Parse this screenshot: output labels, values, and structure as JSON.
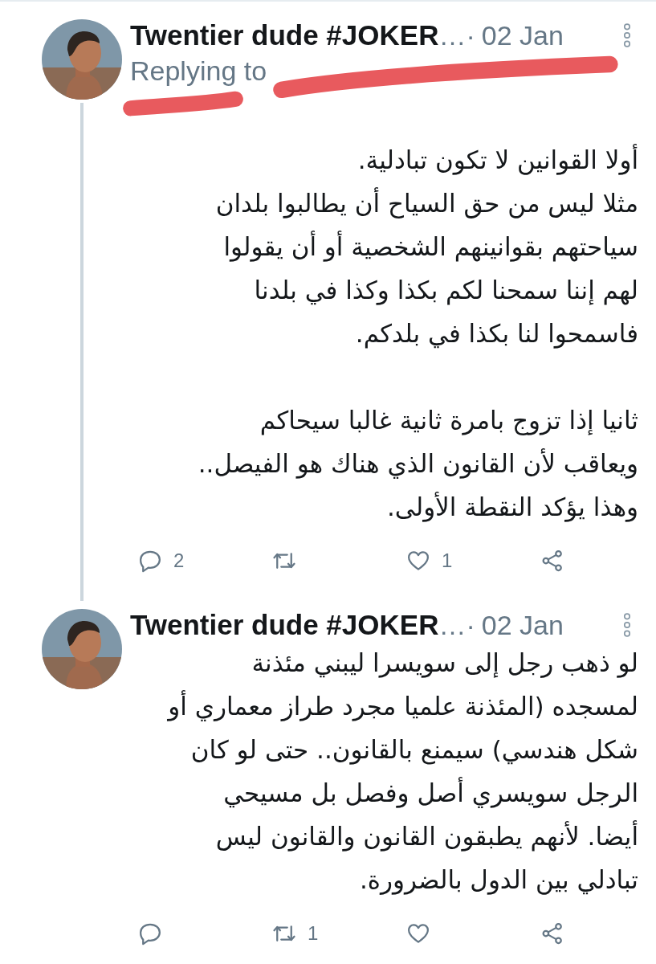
{
  "tweets": [
    {
      "author": "Twentier dude #JOKER",
      "truncation": "…",
      "separator": "·",
      "date": "02 Jan",
      "thread_continues": true,
      "replying_to": "Replying to",
      "paragraphs": [
        "أولا القوانين لا تكون تبادلية.\nمثلا ليس من حق السياح أن يطالبوا بلدان\nسياحتهم بقوانينهم الشخصية أو أن يقولوا\nلهم إننا سمحنا لكم بكذا وكذا في بلدنا\nفاسمحوا لنا بكذا في بلدكم.",
        "ثانيا إذا تزوج بامرة ثانية غالبا سيحاكم\nويعاقب لأن القانون الذي هناك هو الفيصل..\nوهذا يؤكد النقطة الأولى."
      ],
      "reply_count": "2",
      "like_count": "1"
    },
    {
      "author": "Twentier dude #JOKER",
      "truncation": "…",
      "separator": "·",
      "date": "02 Jan",
      "thread_continues": false,
      "paragraphs": [
        "لو ذهب رجل إلى سويسرا ليبني مئذنة\nلمسجده (المئذنة علميا مجرد طراز معماري أو\nشكل هندسي) سيمنع بالقانون.. حتى لو كان\nالرجل سويسري أصل وفصل بل مسيحي\nأيضا. لأنهم يطبقون القانون والقانون ليس\nتبادلي بين الدول بالضرورة."
      ],
      "retweet_count": "1"
    }
  ]
}
